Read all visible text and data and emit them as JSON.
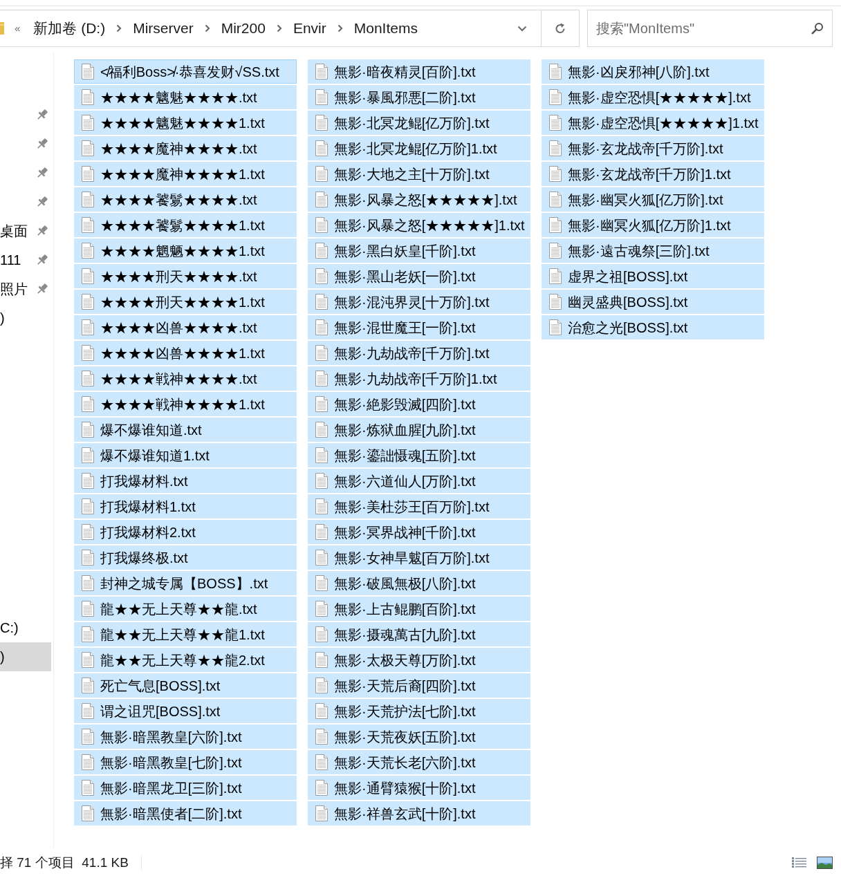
{
  "address_bar": {
    "overflow_mark": "«",
    "breadcrumbs": [
      "新加卷 (D:)",
      "Mirserver",
      "Mir200",
      "Envir",
      "MonItems"
    ]
  },
  "search": {
    "placeholder": "搜索\"MonItems\""
  },
  "nav_pane": {
    "groups": [
      {
        "items": [
          {
            "pinned": true,
            "selected": false
          },
          {
            "pinned": true,
            "selected": false
          },
          {
            "pinned": true,
            "selected": false
          },
          {
            "pinned": true,
            "selected": false
          },
          {
            "label": "桌面",
            "pinned": true,
            "selected": false
          },
          {
            "label": "111",
            "pinned": true,
            "selected": false
          },
          {
            "label": "照片",
            "pinned": true,
            "selected": false
          },
          {
            "label": ")",
            "pinned": false,
            "selected": false
          }
        ]
      },
      {
        "items": [
          {
            "label": "C:)",
            "pinned": false,
            "selected": false
          },
          {
            "label": ")",
            "pinned": false,
            "selected": true
          }
        ]
      }
    ]
  },
  "files": [
    {
      "name": "≮福利Boss≯·恭喜发财√SS.txt",
      "selected": true,
      "focused": true
    },
    {
      "name": "★★★★魑魅★★★★.txt",
      "selected": true,
      "focused": false
    },
    {
      "name": "★★★★魑魅★★★★1.txt",
      "selected": true,
      "focused": false
    },
    {
      "name": "★★★★魔神★★★★.txt",
      "selected": true,
      "focused": false
    },
    {
      "name": "★★★★魔神★★★★1.txt",
      "selected": true,
      "focused": false
    },
    {
      "name": "★★★★饕鬄★★★★.txt",
      "selected": true,
      "focused": false
    },
    {
      "name": "★★★★饕鬄★★★★1.txt",
      "selected": true,
      "focused": false
    },
    {
      "name": "★★★★魍魉★★★★1.txt",
      "selected": true,
      "focused": false
    },
    {
      "name": "★★★★刑天★★★★.txt",
      "selected": true,
      "focused": false
    },
    {
      "name": "★★★★刑天★★★★1.txt",
      "selected": true,
      "focused": false
    },
    {
      "name": "★★★★凶兽★★★★.txt",
      "selected": true,
      "focused": false
    },
    {
      "name": "★★★★凶兽★★★★1.txt",
      "selected": true,
      "focused": false
    },
    {
      "name": "★★★★戦神★★★★.txt",
      "selected": true,
      "focused": false
    },
    {
      "name": "★★★★戦神★★★★1.txt",
      "selected": true,
      "focused": false
    },
    {
      "name": "爆不爆谁知道.txt",
      "selected": true,
      "focused": false
    },
    {
      "name": "爆不爆谁知道1.txt",
      "selected": true,
      "focused": false
    },
    {
      "name": "打我爆材料.txt",
      "selected": true,
      "focused": false
    },
    {
      "name": "打我爆材料1.txt",
      "selected": true,
      "focused": false
    },
    {
      "name": "打我爆材料2.txt",
      "selected": true,
      "focused": false
    },
    {
      "name": "打我爆终极.txt",
      "selected": true,
      "focused": false
    },
    {
      "name": "封神之城专属【BOSS】.txt",
      "selected": true,
      "focused": false
    },
    {
      "name": "龍★★无上天尊★★龍.txt",
      "selected": true,
      "focused": false
    },
    {
      "name": "龍★★无上天尊★★龍1.txt",
      "selected": true,
      "focused": false
    },
    {
      "name": "龍★★无上天尊★★龍2.txt",
      "selected": true,
      "focused": false
    },
    {
      "name": "死亡气息[BOSS].txt",
      "selected": true,
      "focused": false
    },
    {
      "name": "谓之诅咒[BOSS].txt",
      "selected": true,
      "focused": false
    },
    {
      "name": "無影·暗黑教皇[六阶].txt",
      "selected": true,
      "focused": false
    },
    {
      "name": "無影·暗黑教皇[七阶].txt",
      "selected": true,
      "focused": false
    },
    {
      "name": "無影·暗黑龙卫[三阶].txt",
      "selected": true,
      "focused": false
    },
    {
      "name": "無影·暗黑使者[二阶].txt",
      "selected": true,
      "focused": false
    },
    {
      "name": "無影·暗夜精灵[百阶].txt",
      "selected": true,
      "focused": false
    },
    {
      "name": "無影·暴風邪悪[二阶].txt",
      "selected": true,
      "focused": false
    },
    {
      "name": "無影·北冥龙鲲[亿万阶].txt",
      "selected": true,
      "focused": false
    },
    {
      "name": "無影·北冥龙鲲[亿万阶]1.txt",
      "selected": true,
      "focused": false
    },
    {
      "name": "無影·大地之主[十万阶].txt",
      "selected": true,
      "focused": false
    },
    {
      "name": "無影·风暴之怒[★★★★★].txt",
      "selected": true,
      "focused": false
    },
    {
      "name": "無影·风暴之怒[★★★★★]1.txt",
      "selected": true,
      "focused": false
    },
    {
      "name": "無影·黑白妖皇[千阶].txt",
      "selected": true,
      "focused": false
    },
    {
      "name": "無影·黑山老妖[一阶].txt",
      "selected": true,
      "focused": false
    },
    {
      "name": "無影·混沌界灵[十万阶].txt",
      "selected": true,
      "focused": false
    },
    {
      "name": "無影·混世魔王[一阶].txt",
      "selected": true,
      "focused": false
    },
    {
      "name": "無影·九劫战帝[千万阶].txt",
      "selected": true,
      "focused": false
    },
    {
      "name": "無影·九劫战帝[千万阶]1.txt",
      "selected": true,
      "focused": false
    },
    {
      "name": "無影·絶影毁滅[四阶].txt",
      "selected": true,
      "focused": false
    },
    {
      "name": "無影·炼狱血腥[九阶].txt",
      "selected": true,
      "focused": false
    },
    {
      "name": "無影·鎏詘慑魂[五阶].txt",
      "selected": true,
      "focused": false
    },
    {
      "name": "無影·六道仙人[万阶].txt",
      "selected": true,
      "focused": false
    },
    {
      "name": "無影·美杜莎王[百万阶].txt",
      "selected": true,
      "focused": false
    },
    {
      "name": "無影·冥界战神[千阶].txt",
      "selected": true,
      "focused": false
    },
    {
      "name": "無影·女神旱魃[百万阶].txt",
      "selected": true,
      "focused": false
    },
    {
      "name": "無影·破風無极[八阶].txt",
      "selected": true,
      "focused": false
    },
    {
      "name": "無影·上古鲲鹏[百阶].txt",
      "selected": true,
      "focused": false
    },
    {
      "name": "無影·摄魂萬古[九阶].txt",
      "selected": true,
      "focused": false
    },
    {
      "name": "無影·太极天尊[万阶].txt",
      "selected": true,
      "focused": false
    },
    {
      "name": "無影·天荒后裔[四阶].txt",
      "selected": true,
      "focused": false
    },
    {
      "name": "無影·天荒护法[七阶].txt",
      "selected": true,
      "focused": false
    },
    {
      "name": "無影·天荒夜妖[五阶].txt",
      "selected": true,
      "focused": false
    },
    {
      "name": "無影·天荒长老[六阶].txt",
      "selected": true,
      "focused": false
    },
    {
      "name": "無影·通臂猿猴[十阶].txt",
      "selected": true,
      "focused": false
    },
    {
      "name": "無影·祥兽玄武[十阶].txt",
      "selected": true,
      "focused": false
    },
    {
      "name": "無影·凶戾邪神[八阶].txt",
      "selected": true,
      "focused": false
    },
    {
      "name": "無影·虚空恐惧[★★★★★].txt",
      "selected": true,
      "focused": false
    },
    {
      "name": "無影·虚空恐惧[★★★★★]1.txt",
      "selected": true,
      "focused": false
    },
    {
      "name": "無影·玄龙战帝[千万阶].txt",
      "selected": true,
      "focused": false
    },
    {
      "name": "無影·玄龙战帝[千万阶]1.txt",
      "selected": true,
      "focused": false
    },
    {
      "name": "無影·幽冥火狐[亿万阶].txt",
      "selected": true,
      "focused": false
    },
    {
      "name": "無影·幽冥火狐[亿万阶]1.txt",
      "selected": true,
      "focused": false
    },
    {
      "name": "無影·遠古魂祭[三阶].txt",
      "selected": true,
      "focused": false
    },
    {
      "name": "虚界之祖[BOSS].txt",
      "selected": true,
      "focused": false
    },
    {
      "name": "幽灵盛典[BOSS].txt",
      "selected": true,
      "focused": false
    },
    {
      "name": "治愈之光[BOSS].txt",
      "selected": true,
      "focused": false
    }
  ],
  "status_bar": {
    "selection": "择 71 个项目  41.1 KB"
  }
}
